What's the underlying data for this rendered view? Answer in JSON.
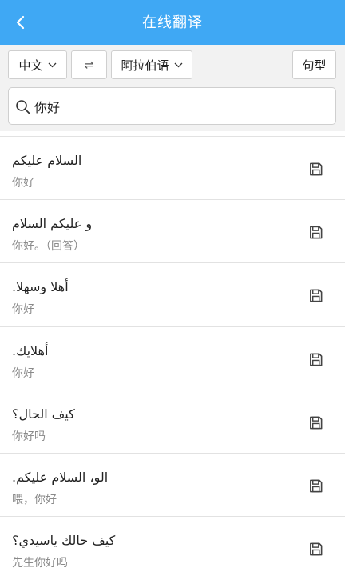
{
  "header": {
    "title": "在线翻译",
    "back_icon": "chevron-left-icon"
  },
  "toolbar": {
    "source_lang": "中文",
    "swap_symbol": "⇌",
    "target_lang": "阿拉伯语",
    "pattern_label": "句型"
  },
  "search": {
    "value": "你好",
    "icon": "search-icon"
  },
  "colors": {
    "header_bg": "#3fa8f4",
    "toolbar_bg": "#f2f2f2",
    "divider": "#e2e2e2",
    "secondary_text": "#8a8a8a"
  },
  "results": [
    {
      "arabic": "السلام عليكم",
      "chinese": "你好"
    },
    {
      "arabic": "و عليكم السلام",
      "chinese": "你好。（回答）"
    },
    {
      "arabic": "أهلا وسهلا.",
      "chinese": "你好"
    },
    {
      "arabic": "أهلايك.",
      "chinese": "你好"
    },
    {
      "arabic": "كيف الحال؟",
      "chinese": "你好吗"
    },
    {
      "arabic": "الو، السلام عليكم.",
      "chinese": "喂，你好"
    },
    {
      "arabic": "كيف حالك ياسيدي؟",
      "chinese": "先生你好吗"
    }
  ]
}
